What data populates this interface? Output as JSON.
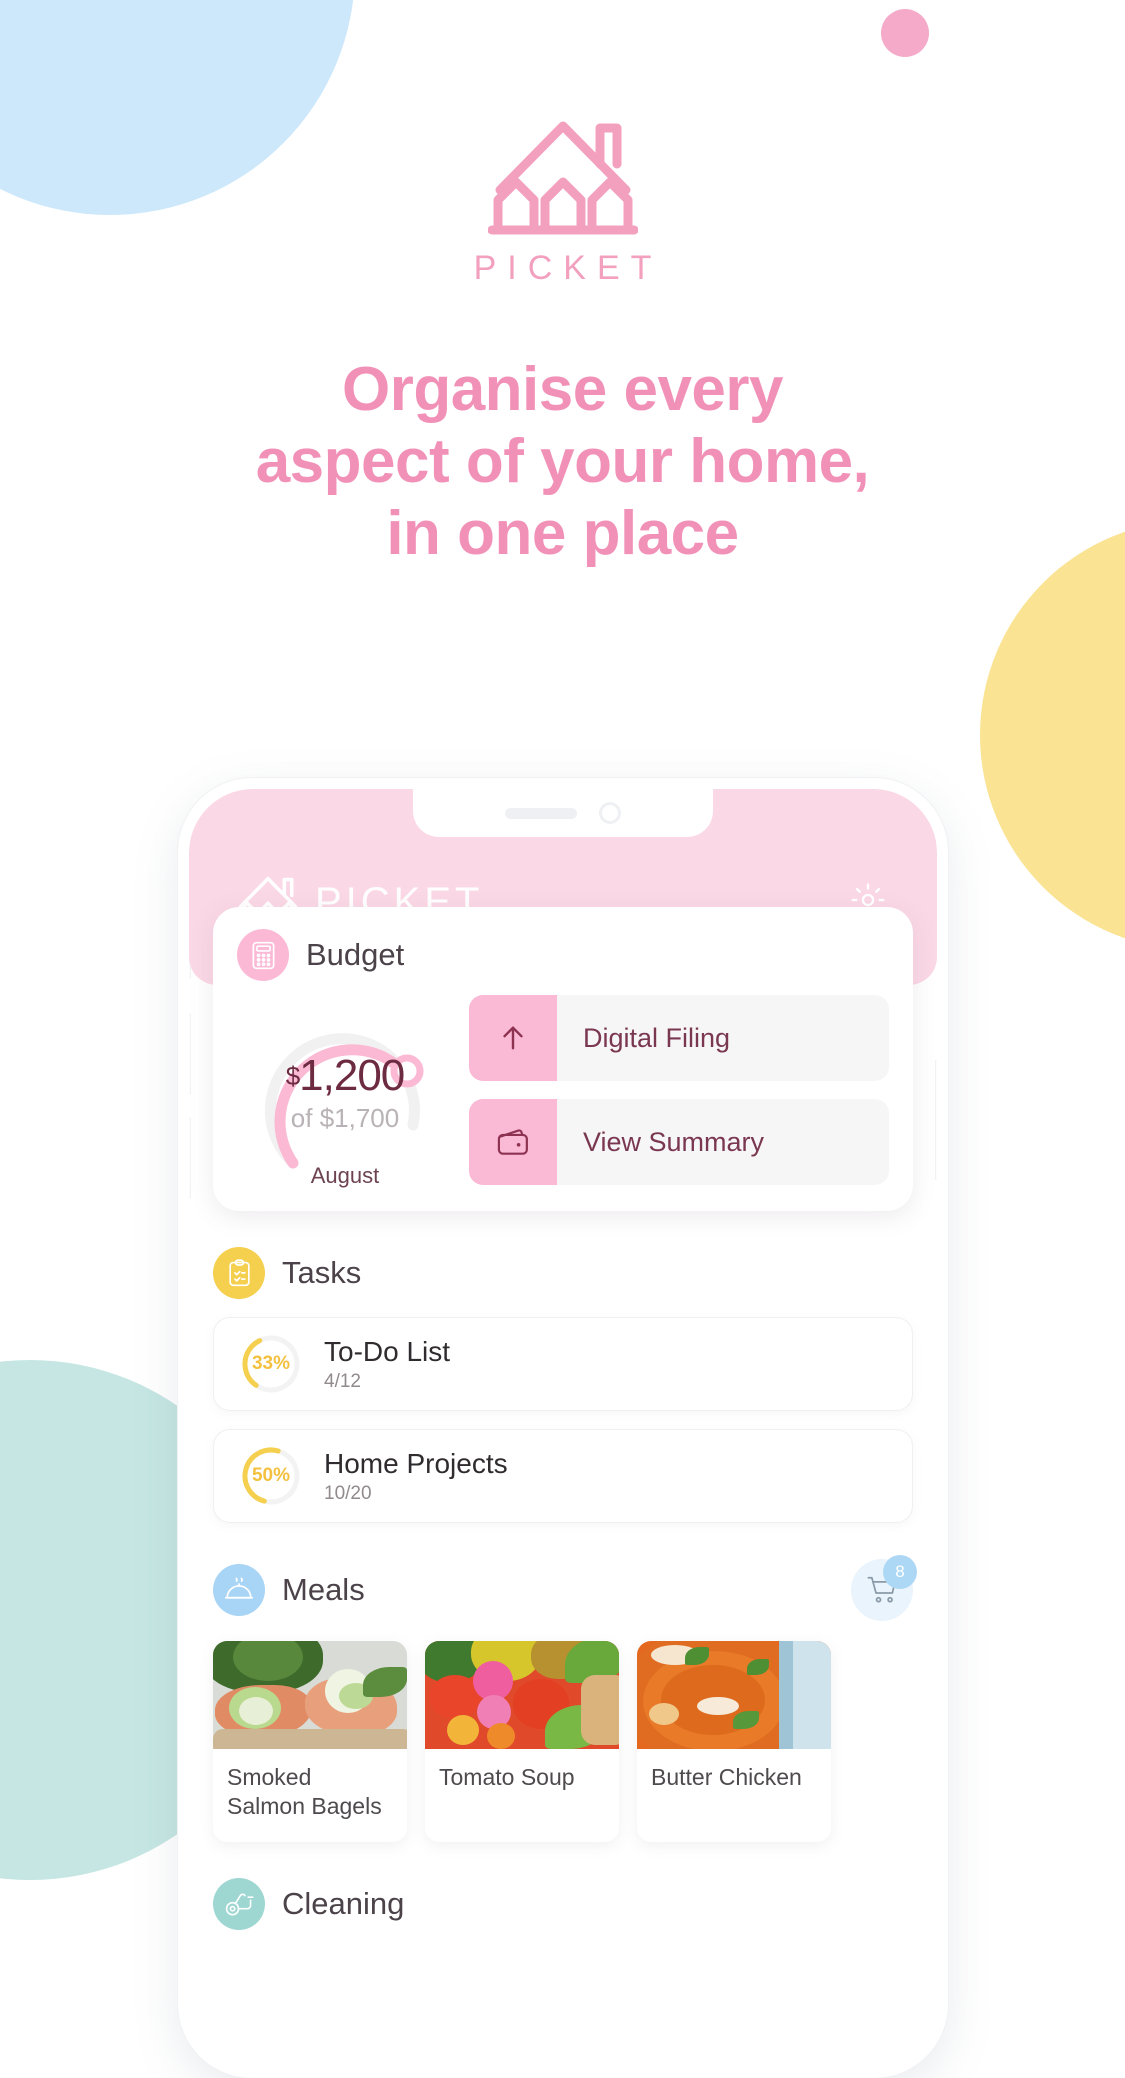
{
  "brand": {
    "logo_icon": "picket-house-icon",
    "wordmark": "PICKET"
  },
  "headline": {
    "line1": "Organise every",
    "line2": "aspect of your home,",
    "line3": "in one place"
  },
  "colors": {
    "brand_pink": "#f291b7",
    "header_pink": "#fbd8e6",
    "accent_pink": "#fab9d4",
    "task_yellow": "#f3c13f",
    "meal_blue": "#a8d4f5",
    "clean_teal": "#9ed6d2",
    "blob_blue": "#cde8fb",
    "blob_yellow": "#fae392",
    "blob_teal": "#c5e6e3",
    "blob_pink": "#f4aac8",
    "value_maroon": "#6d2b41"
  },
  "app": {
    "header": {
      "wordmark": "PICKET",
      "logo_icon": "picket-house-icon",
      "settings_icon": "gear-icon"
    },
    "budget": {
      "icon": "calculator-icon",
      "title": "Budget",
      "currency_symbol": "$",
      "amount": "1,200",
      "of_label": "of $1,700",
      "month": "August",
      "progress_percent": 70,
      "actions": [
        {
          "icon": "arrow-up-icon",
          "label": "Digital Filing"
        },
        {
          "icon": "wallet-icon",
          "label": "View Summary"
        }
      ]
    },
    "tasks": {
      "icon": "clipboard-icon",
      "title": "Tasks",
      "items": [
        {
          "percent_label": "33%",
          "percent": 33,
          "name": "To-Do List",
          "progress": "4/12"
        },
        {
          "percent_label": "50%",
          "percent": 50,
          "name": "Home Projects",
          "progress": "10/20"
        }
      ]
    },
    "meals": {
      "icon": "cloche-icon",
      "title": "Meals",
      "cart_icon": "shopping-cart-icon",
      "cart_count": "8",
      "items": [
        {
          "name": "Smoked Salmon Bagels"
        },
        {
          "name": "Tomato Soup"
        },
        {
          "name": "Butter Chicken"
        }
      ]
    },
    "cleaning": {
      "icon": "vacuum-icon",
      "title": "Cleaning"
    }
  }
}
